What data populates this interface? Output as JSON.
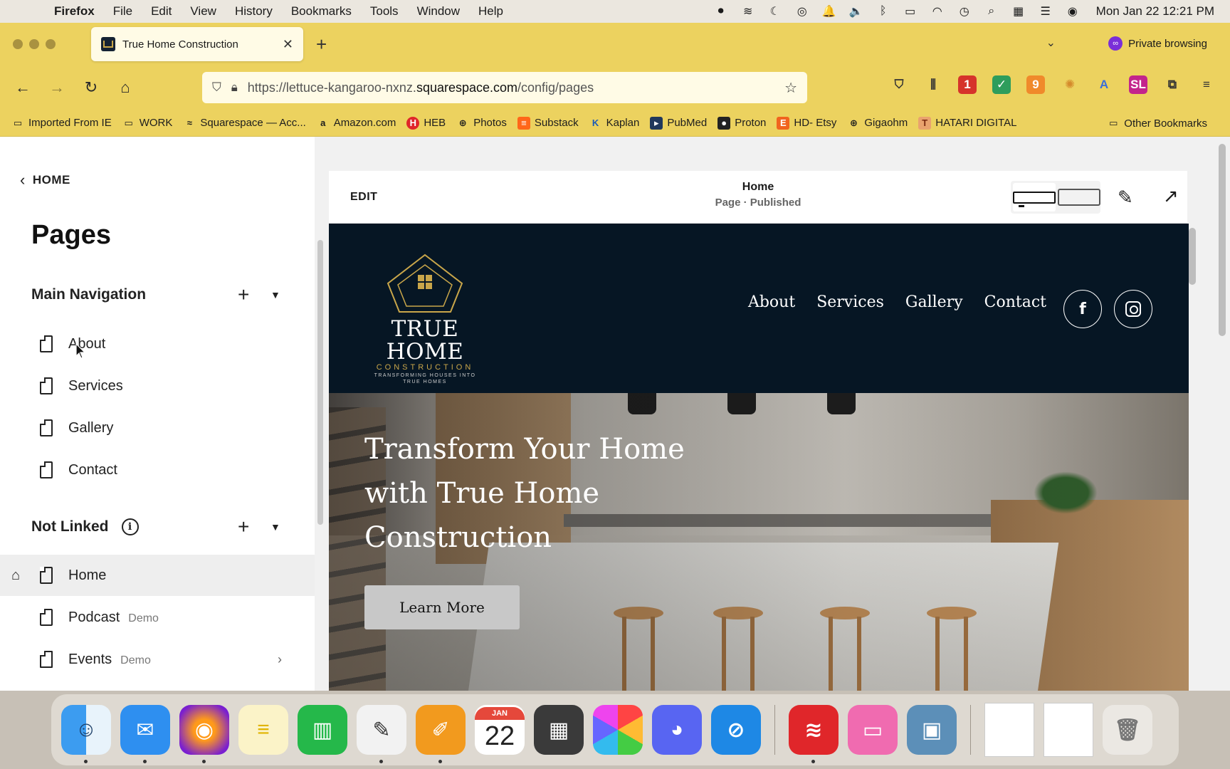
{
  "menubar": {
    "app": "Firefox",
    "items": [
      "File",
      "Edit",
      "View",
      "History",
      "Bookmarks",
      "Tools",
      "Window",
      "Help"
    ],
    "clock": "Mon Jan 22  12:21 PM"
  },
  "browser": {
    "tab_title": "True Home Construction",
    "private_label": "Private browsing",
    "url_prefix": "https://lettuce-kangaroo-nxnz.",
    "url_domain": "squarespace.com",
    "url_path": "/config/pages",
    "toolbar_badges": [
      "1",
      "9"
    ],
    "bookmarks": [
      {
        "label": "Imported From IE",
        "icon": "folder-icon"
      },
      {
        "label": "WORK",
        "icon": "folder-icon"
      },
      {
        "label": "Squarespace — Acc...",
        "icon": "squarespace-icon"
      },
      {
        "label": "Amazon.com",
        "icon": "amazon-icon",
        "glyph": "a"
      },
      {
        "label": "HEB",
        "icon": "heb-icon",
        "glyph": "H"
      },
      {
        "label": "Photos",
        "icon": "globe-icon"
      },
      {
        "label": "Substack",
        "icon": "substack-icon"
      },
      {
        "label": "Kaplan",
        "icon": "kaplan-icon"
      },
      {
        "label": "PubMed",
        "icon": "pubmed-icon"
      },
      {
        "label": "Proton",
        "icon": "proton-icon"
      },
      {
        "label": "HD- Etsy",
        "icon": "etsy-icon",
        "glyph": "E"
      },
      {
        "label": "Gigaohm",
        "icon": "globe-icon"
      },
      {
        "label": "HATARI DIGITAL",
        "icon": "hatari-icon"
      }
    ],
    "other_bookmarks": "Other Bookmarks"
  },
  "sidebar": {
    "back_label": "HOME",
    "title": "Pages",
    "main_nav_label": "Main Navigation",
    "main_nav_items": [
      "About",
      "Services",
      "Gallery",
      "Contact"
    ],
    "not_linked_label": "Not Linked",
    "not_linked_items": [
      {
        "label": "Home",
        "tag": ""
      },
      {
        "label": "Podcast",
        "tag": "Demo"
      },
      {
        "label": "Events",
        "tag": "Demo"
      }
    ]
  },
  "editor": {
    "edit_label": "EDIT",
    "page_title": "Home",
    "page_status": "Page · Published"
  },
  "site": {
    "logo_name": "TRUE HOME",
    "logo_sub": "CONSTRUCTION",
    "logo_tagline": "TRANSFORMING HOUSES INTO TRUE HOMES",
    "nav": [
      "About",
      "Services",
      "Gallery",
      "Contact"
    ],
    "social": [
      "facebook-icon",
      "instagram-icon"
    ],
    "hero_title": "Transform Your Home with True Home Construction",
    "hero_button": "Learn More"
  },
  "dock": {
    "calendar_month": "JAN",
    "calendar_day": "22"
  },
  "colors": {
    "firefox_toolbar": "#ecd25f",
    "site_header": "#061624",
    "logo_gold": "#c9a64a"
  }
}
